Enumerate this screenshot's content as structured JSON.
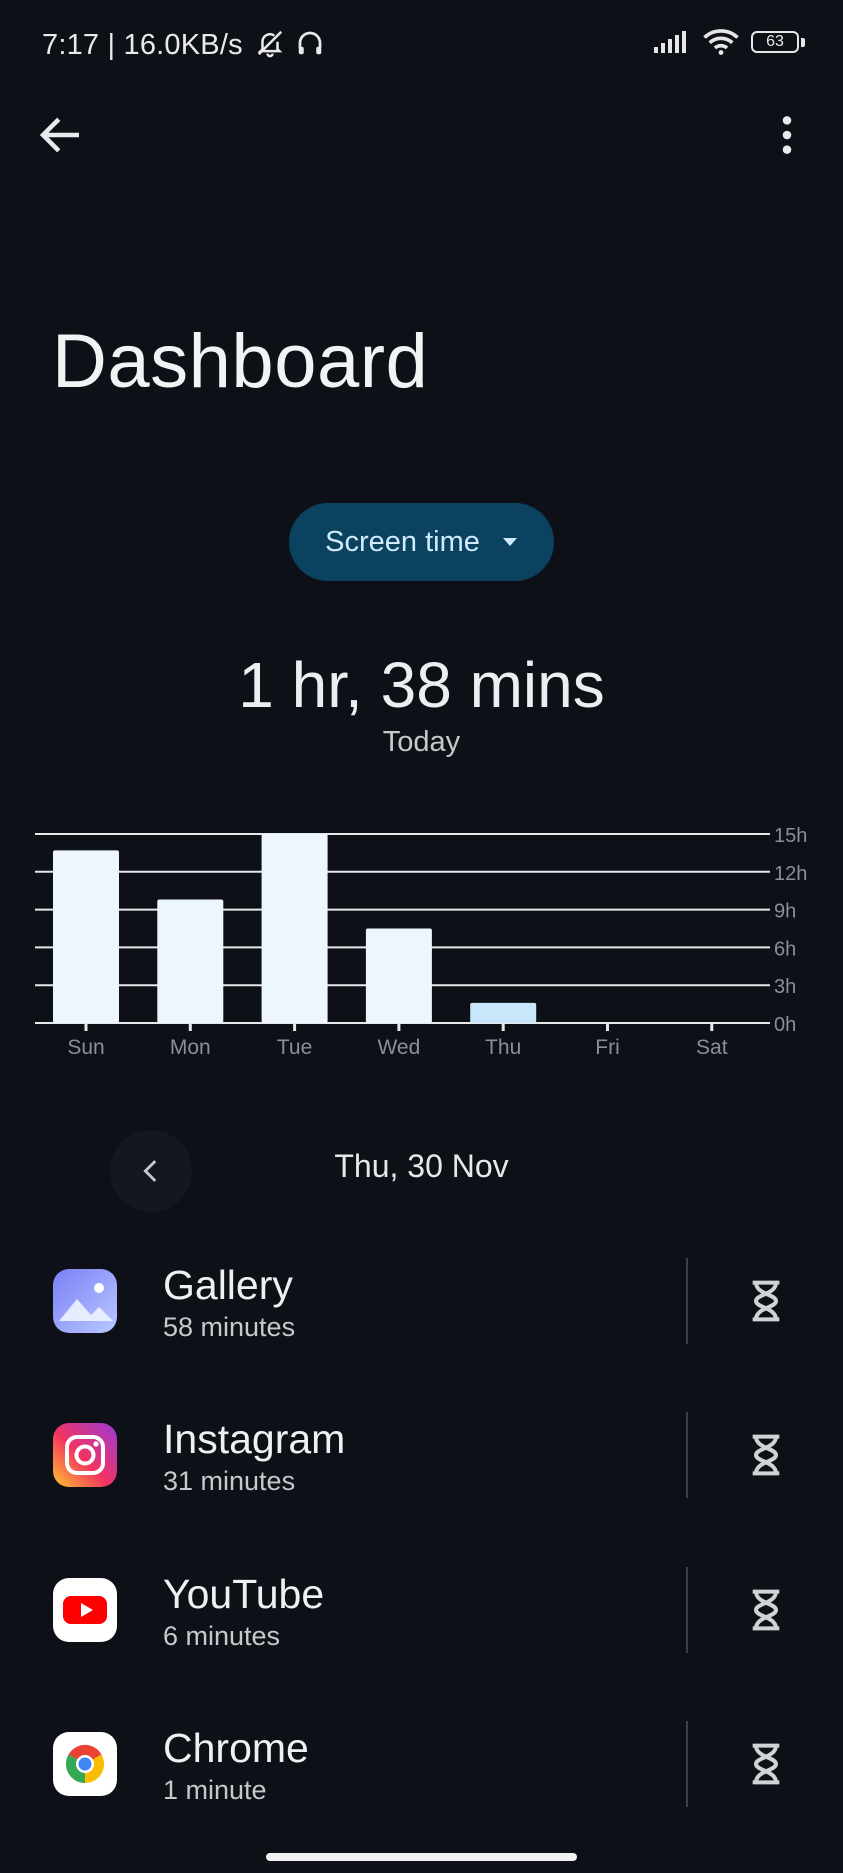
{
  "status_bar": {
    "time_text": "7:17 | 16.0KB/s",
    "battery": "63"
  },
  "header": {
    "title": "Dashboard"
  },
  "metric_selector": {
    "label": "Screen time"
  },
  "summary": {
    "total": "1 hr, 38 mins",
    "period": "Today"
  },
  "chart_data": {
    "type": "bar",
    "categories": [
      "Sun",
      "Mon",
      "Tue",
      "Wed",
      "Thu",
      "Fri",
      "Sat"
    ],
    "values": [
      13.7,
      9.8,
      15.0,
      7.5,
      1.6,
      0,
      0
    ],
    "selected_index": 4,
    "y_ticks": [
      "0h",
      "3h",
      "6h",
      "9h",
      "12h",
      "15h"
    ],
    "ylim": [
      0,
      15
    ],
    "grid": true,
    "colors": {
      "bar": "#eef6fd",
      "selected": "#c9e7fb",
      "grid": "#e6e8ea",
      "label": "#8a8f95"
    }
  },
  "date_nav": {
    "current": "Thu, 30 Nov"
  },
  "apps": [
    {
      "name": "Gallery",
      "usage": "58 minutes",
      "icon": "gallery-icon"
    },
    {
      "name": "Instagram",
      "usage": "31 minutes",
      "icon": "instagram-icon"
    },
    {
      "name": "YouTube",
      "usage": "6 minutes",
      "icon": "youtube-icon"
    },
    {
      "name": "Chrome",
      "usage": "1 minute",
      "icon": "chrome-icon"
    }
  ]
}
